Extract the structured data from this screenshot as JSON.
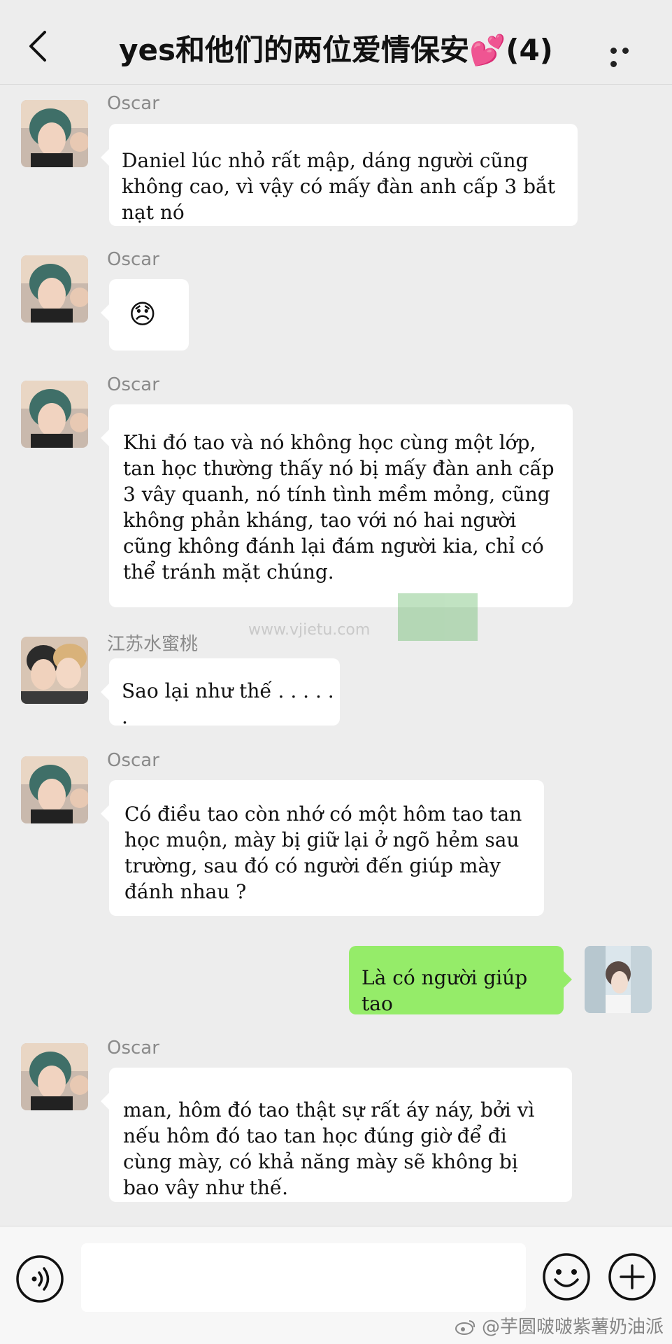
{
  "header": {
    "title": "yes和他们的两位爱情保安💕(4)"
  },
  "messages": [
    {
      "sender": "Oscar",
      "text": "Daniel lúc nhỏ rất mập, dáng người cũng không cao, vì vậy có mấy đàn anh cấp 3 bắt nạt nó"
    },
    {
      "sender": "Oscar",
      "text": "😞"
    },
    {
      "sender": "Oscar",
      "text": "Khi đó tao và nó không học cùng một lớp, tan học thường thấy nó bị mấy đàn anh cấp 3 vây quanh, nó tính tình mềm mỏng, cũng không phản kháng, tao với nó hai người cũng không đánh lại đám người kia, chỉ có thể tránh mặt chúng."
    },
    {
      "sender": "江苏水蜜桃",
      "text": "Sao lại như thế . . . . . ."
    },
    {
      "sender": "Oscar",
      "text": "Có điều tao còn nhớ có một hôm tao tan học muộn, mày bị giữ lại ở ngõ hẻm sau trường, sau đó có người đến giúp mày đánh nhau ?"
    },
    {
      "sender": "",
      "text": "Là có người giúp tao"
    },
    {
      "sender": "Oscar",
      "text": "man, hôm đó tao thật sự rất áy náy, bởi vì nếu hôm đó tao tan học đúng giờ để đi cùng mày, có khả năng mày sẽ không bị bao vây như thế."
    }
  ],
  "watermark": {
    "url": "www.vjietu.com"
  },
  "footer": {
    "weibo_handle": "@芋圆啵啵紫薯奶油派"
  },
  "colors": {
    "background": "#ededed",
    "bubble_left": "#ffffff",
    "bubble_right": "#95ec69"
  },
  "icons": [
    "back-icon",
    "more-icon",
    "voice-icon",
    "emoji-icon",
    "plus-icon",
    "weibo-icon"
  ]
}
